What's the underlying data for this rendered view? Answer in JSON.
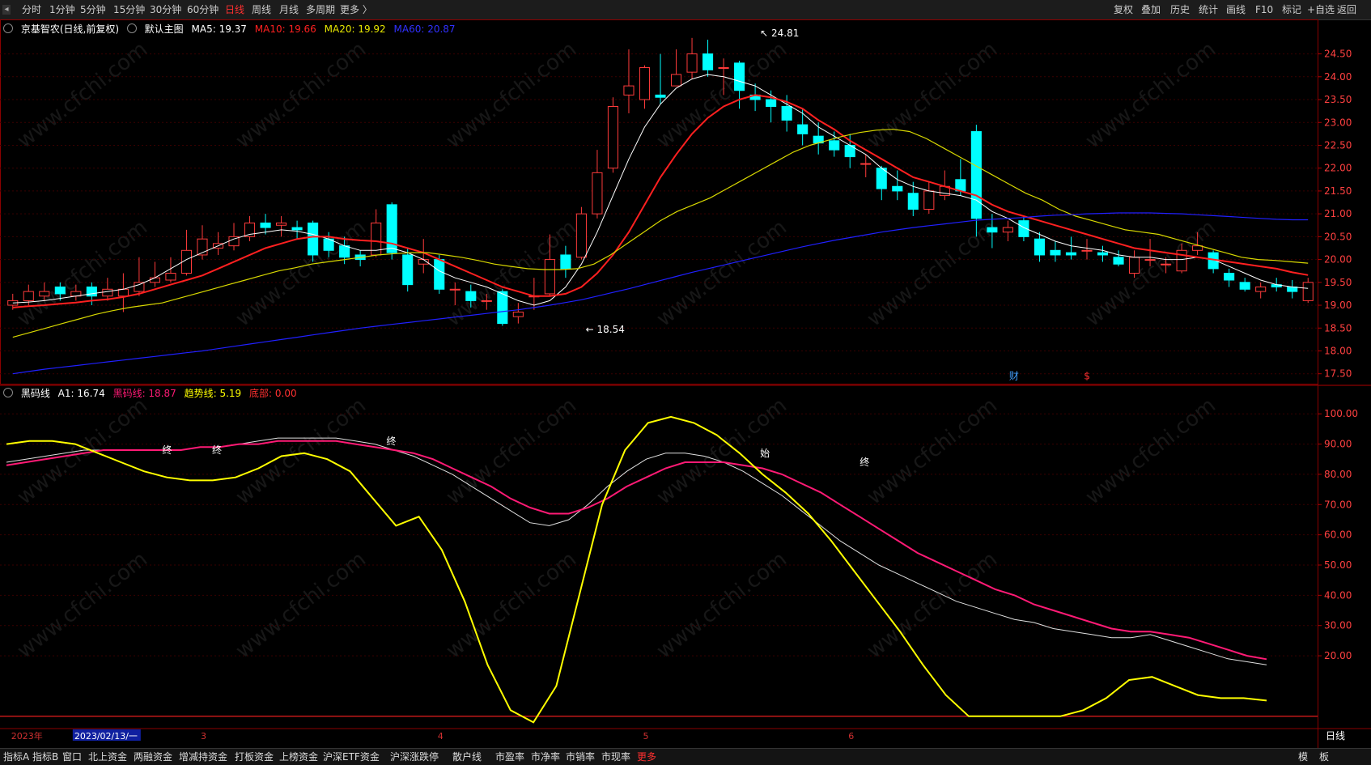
{
  "toolbar": {
    "periods": [
      "分时",
      "1分钟",
      "5分钟",
      "15分钟",
      "30分钟",
      "60分钟",
      "日线",
      "周线",
      "月线",
      "多周期",
      "更多 〉"
    ],
    "active_period": "日线",
    "right_buttons": [
      "复权",
      "叠加",
      "历史",
      "统计",
      "画线",
      "F10",
      "标记",
      "+自选",
      "返回"
    ]
  },
  "main_legend": {
    "stock": "京基智农(日线,前复权)",
    "template": "默认主图",
    "ma5": "MA5: 19.37",
    "ma10": "MA10: 19.66",
    "ma20": "MA20: 19.92",
    "ma60": "MA60: 20.87"
  },
  "sub_legend": {
    "name": "黑码线",
    "a1": "A1: 16.74",
    "hml": "黑码线: 18.87",
    "trend": "趋势线: 5.19",
    "bottom": "底部: 0.00"
  },
  "bottom_tabs": [
    "指标A",
    "指标B",
    "窗口",
    "北上资金",
    "两融资金",
    "增减持资金",
    "打板资金",
    "上榜资金",
    "沪深ETF资金",
    "沪深涨跌停",
    "散户线",
    "市盈率",
    "市净率",
    "市销率",
    "市现率",
    "更多"
  ],
  "bottom_right": [
    "模",
    "板"
  ],
  "period_label": "日线",
  "watermark": "www.cfchi.com",
  "colors": {
    "up": "#ff3b3b",
    "down": "#00ffff",
    "ma5": "#ffffff",
    "ma10": "#ff2020",
    "ma20": "#d8d800",
    "ma60": "#2020ff",
    "hml": "#ff1a75",
    "trend": "#ffff00",
    "a1": "#e0e0e0"
  },
  "chart_data": [
    {
      "type": "candlestick",
      "title": "京基智农(日线,前复权)",
      "ylim": [
        17.3,
        24.9
      ],
      "yticks": [
        17.5,
        18.0,
        18.5,
        19.0,
        19.5,
        20.0,
        20.5,
        21.0,
        21.5,
        22.0,
        22.5,
        23.0,
        23.5,
        24.0,
        24.5
      ],
      "annotations": [
        {
          "label": "24.81",
          "x": 30,
          "y": 24.81
        },
        {
          "label": "18.54",
          "x": 23,
          "y": 18.54
        },
        {
          "label": "财",
          "x": 40,
          "y": 17.45
        },
        {
          "label": "$",
          "x": 43,
          "y": 17.45
        }
      ],
      "x_labels": [
        {
          "label": "2023年",
          "x": 0
        },
        {
          "label": "2023/02/13/一",
          "x": 4
        },
        {
          "label": "3",
          "x": 12
        },
        {
          "label": "4",
          "x": 27
        },
        {
          "label": "5",
          "x": 40
        },
        {
          "label": "6",
          "x": 53
        }
      ],
      "candles": [
        [
          19.0,
          19.1,
          19.25,
          18.9
        ],
        [
          19.1,
          19.3,
          19.45,
          19.0
        ],
        [
          19.2,
          19.3,
          19.5,
          19.1
        ],
        [
          19.4,
          19.25,
          19.5,
          19.1
        ],
        [
          19.2,
          19.3,
          19.45,
          19.1
        ],
        [
          19.4,
          19.2,
          19.5,
          19.0
        ],
        [
          19.2,
          19.35,
          19.6,
          19.1
        ],
        [
          19.2,
          19.35,
          19.7,
          18.85
        ],
        [
          19.3,
          19.5,
          20.05,
          19.2
        ],
        [
          19.5,
          19.6,
          19.95,
          19.4
        ],
        [
          19.55,
          19.7,
          20.05,
          19.5
        ],
        [
          19.7,
          20.2,
          20.65,
          19.65
        ],
        [
          20.1,
          20.45,
          20.75,
          20.0
        ],
        [
          20.25,
          20.35,
          20.6,
          20.1
        ],
        [
          20.3,
          20.5,
          20.8,
          20.2
        ],
        [
          20.5,
          20.8,
          20.95,
          20.4
        ],
        [
          20.8,
          20.7,
          21.0,
          20.55
        ],
        [
          20.75,
          20.8,
          20.95,
          20.5
        ],
        [
          20.7,
          20.65,
          20.85,
          20.45
        ],
        [
          20.8,
          20.1,
          20.85,
          19.95
        ],
        [
          20.45,
          20.2,
          20.6,
          20.05
        ],
        [
          20.3,
          20.05,
          20.5,
          19.9
        ],
        [
          20.1,
          20.0,
          20.2,
          19.85
        ],
        [
          20.1,
          20.8,
          21.1,
          20.05
        ],
        [
          21.2,
          20.15,
          21.25,
          20.0
        ],
        [
          20.1,
          19.45,
          20.25,
          19.3
        ],
        [
          19.9,
          20.0,
          20.45,
          19.7
        ],
        [
          20.0,
          19.35,
          20.1,
          19.25
        ],
        [
          19.35,
          19.35,
          19.5,
          19.0
        ],
        [
          19.3,
          19.1,
          19.45,
          18.95
        ],
        [
          19.1,
          19.1,
          19.25,
          18.9
        ],
        [
          19.3,
          18.6,
          19.35,
          18.55
        ],
        [
          18.75,
          18.85,
          19.05,
          18.6
        ],
        [
          19.2,
          19.2,
          19.6,
          18.9
        ],
        [
          19.25,
          20.0,
          20.55,
          19.2
        ],
        [
          20.1,
          19.8,
          20.3,
          19.6
        ],
        [
          20.05,
          21.0,
          21.15,
          20.0
        ],
        [
          21.0,
          21.9,
          22.4,
          20.9
        ],
        [
          22.0,
          23.35,
          23.55,
          21.9
        ],
        [
          23.6,
          23.8,
          24.6,
          23.2
        ],
        [
          23.5,
          24.2,
          24.25,
          23.3
        ],
        [
          23.6,
          23.55,
          24.5,
          23.4
        ],
        [
          23.8,
          24.05,
          24.6,
          23.8
        ],
        [
          24.1,
          24.5,
          24.85,
          23.95
        ],
        [
          24.5,
          24.15,
          24.81,
          24.0
        ],
        [
          24.2,
          24.2,
          24.4,
          23.6
        ],
        [
          24.3,
          23.7,
          24.35,
          23.3
        ],
        [
          23.6,
          23.5,
          23.85,
          23.25
        ],
        [
          23.5,
          23.35,
          23.7,
          23.0
        ],
        [
          23.35,
          23.05,
          23.6,
          22.8
        ],
        [
          22.95,
          22.75,
          23.3,
          22.5
        ],
        [
          22.7,
          22.55,
          23.0,
          22.3
        ],
        [
          22.6,
          22.4,
          22.8,
          22.25
        ],
        [
          22.5,
          22.25,
          22.75,
          22.0
        ],
        [
          22.1,
          22.1,
          22.3,
          21.8
        ],
        [
          22.0,
          21.55,
          22.05,
          21.3
        ],
        [
          21.6,
          21.5,
          21.95,
          21.3
        ],
        [
          21.45,
          21.1,
          21.7,
          20.95
        ],
        [
          21.1,
          21.5,
          21.7,
          21.0
        ],
        [
          21.4,
          21.6,
          21.95,
          21.3
        ],
        [
          21.75,
          21.5,
          22.2,
          21.4
        ],
        [
          22.8,
          20.9,
          22.95,
          20.5
        ],
        [
          20.7,
          20.6,
          21.0,
          20.25
        ],
        [
          20.6,
          20.7,
          20.85,
          20.4
        ],
        [
          20.85,
          20.5,
          20.95,
          20.4
        ],
        [
          20.45,
          20.1,
          20.6,
          19.95
        ],
        [
          20.2,
          20.1,
          20.4,
          19.95
        ],
        [
          20.15,
          20.1,
          20.5,
          20.0
        ],
        [
          20.2,
          20.2,
          20.45,
          20.0
        ],
        [
          20.15,
          20.1,
          20.3,
          19.95
        ],
        [
          20.05,
          19.9,
          20.2,
          19.85
        ],
        [
          19.7,
          20.05,
          20.2,
          19.6
        ],
        [
          20.0,
          20.0,
          20.45,
          19.85
        ],
        [
          19.9,
          19.9,
          20.05,
          19.7
        ],
        [
          19.75,
          20.2,
          20.35,
          19.7
        ],
        [
          20.2,
          20.3,
          20.6,
          20.1
        ],
        [
          20.15,
          19.8,
          20.2,
          19.7
        ],
        [
          19.7,
          19.55,
          19.8,
          19.4
        ],
        [
          19.5,
          19.35,
          19.6,
          19.3
        ],
        [
          19.3,
          19.4,
          19.5,
          19.15
        ],
        [
          19.45,
          19.4,
          19.6,
          19.3
        ],
        [
          19.4,
          19.3,
          19.55,
          19.15
        ],
        [
          19.1,
          19.5,
          19.6,
          19.05
        ]
      ],
      "series": [
        {
          "name": "MA5",
          "values": [
            19.05,
            19.07,
            19.1,
            19.15,
            19.2,
            19.25,
            19.3,
            19.35,
            19.45,
            19.6,
            19.8,
            20.0,
            20.15,
            20.3,
            20.45,
            20.55,
            20.6,
            20.65,
            20.62,
            20.55,
            20.45,
            20.3,
            20.2,
            20.2,
            20.25,
            20.15,
            20.0,
            19.75,
            19.6,
            19.5,
            19.4,
            19.25,
            19.1,
            19.0,
            19.1,
            19.4,
            19.9,
            20.6,
            21.4,
            22.2,
            22.9,
            23.4,
            23.75,
            23.95,
            24.05,
            24.0,
            23.9,
            23.8,
            23.6,
            23.4,
            23.2,
            22.9,
            22.7,
            22.5,
            22.3,
            22.0,
            21.75,
            21.6,
            21.5,
            21.45,
            21.4,
            21.3,
            21.05,
            20.9,
            20.7,
            20.55,
            20.4,
            20.3,
            20.25,
            20.2,
            20.1,
            20.05,
            20.05,
            20.0,
            20.0,
            20.05,
            20.0,
            19.85,
            19.7,
            19.55,
            19.45,
            19.4,
            19.37
          ]
        },
        {
          "name": "MA10",
          "values": [
            18.95,
            18.98,
            19.0,
            19.03,
            19.06,
            19.1,
            19.13,
            19.18,
            19.25,
            19.35,
            19.45,
            19.55,
            19.65,
            19.8,
            19.95,
            20.1,
            20.25,
            20.35,
            20.45,
            20.5,
            20.5,
            20.45,
            20.42,
            20.4,
            20.35,
            20.25,
            20.15,
            20.0,
            19.85,
            19.7,
            19.55,
            19.4,
            19.3,
            19.2,
            19.2,
            19.25,
            19.4,
            19.7,
            20.1,
            20.6,
            21.2,
            21.8,
            22.3,
            22.75,
            23.1,
            23.35,
            23.5,
            23.6,
            23.55,
            23.45,
            23.3,
            23.05,
            22.85,
            22.6,
            22.4,
            22.2,
            22.0,
            21.8,
            21.7,
            21.6,
            21.5,
            21.4,
            21.2,
            21.05,
            20.95,
            20.85,
            20.75,
            20.65,
            20.55,
            20.45,
            20.35,
            20.25,
            20.2,
            20.15,
            20.1,
            20.05,
            20.0,
            19.95,
            19.9,
            19.85,
            19.8,
            19.72,
            19.66
          ]
        },
        {
          "name": "MA20",
          "values": [
            18.3,
            18.4,
            18.5,
            18.6,
            18.7,
            18.8,
            18.88,
            18.95,
            19.0,
            19.05,
            19.15,
            19.25,
            19.35,
            19.45,
            19.55,
            19.65,
            19.75,
            19.82,
            19.9,
            19.95,
            20.0,
            20.05,
            20.1,
            20.13,
            20.15,
            20.15,
            20.1,
            20.05,
            19.98,
            19.9,
            19.85,
            19.8,
            19.78,
            19.78,
            19.8,
            19.9,
            20.1,
            20.35,
            20.6,
            20.85,
            21.05,
            21.2,
            21.35,
            21.55,
            21.75,
            21.95,
            22.15,
            22.35,
            22.5,
            22.6,
            22.7,
            22.78,
            22.83,
            22.85,
            22.8,
            22.65,
            22.45,
            22.25,
            22.05,
            21.85,
            21.65,
            21.45,
            21.3,
            21.1,
            20.95,
            20.85,
            20.75,
            20.65,
            20.6,
            20.55,
            20.45,
            20.35,
            20.25,
            20.15,
            20.05,
            20.0,
            19.98,
            19.95,
            19.92
          ]
        },
        {
          "name": "MA60",
          "values": [
            17.5,
            17.55,
            17.6,
            17.64,
            17.68,
            17.72,
            17.76,
            17.8,
            17.84,
            17.88,
            17.92,
            17.96,
            18.0,
            18.05,
            18.1,
            18.15,
            18.2,
            18.25,
            18.3,
            18.35,
            18.4,
            18.45,
            18.5,
            18.54,
            18.58,
            18.62,
            18.66,
            18.7,
            18.74,
            18.78,
            18.82,
            18.86,
            18.9,
            18.95,
            19.0,
            19.06,
            19.12,
            19.2,
            19.28,
            19.36,
            19.45,
            19.54,
            19.63,
            19.72,
            19.8,
            19.88,
            19.96,
            20.04,
            20.12,
            20.2,
            20.28,
            20.35,
            20.42,
            20.48,
            20.54,
            20.6,
            20.65,
            20.7,
            20.74,
            20.78,
            20.82,
            20.86,
            20.88,
            20.9,
            20.92,
            20.95,
            20.97,
            20.98,
            21.0,
            21.01,
            21.02,
            21.02,
            21.02,
            21.01,
            21.0,
            20.98,
            20.96,
            20.94,
            20.92,
            20.9,
            20.88,
            20.87,
            20.87
          ]
        }
      ]
    },
    {
      "type": "line",
      "title": "黑码线",
      "ylim": [
        -3,
        103
      ],
      "yticks": [
        20,
        30,
        40,
        50,
        60,
        70,
        80,
        90,
        100
      ],
      "baseline": 0,
      "annotations": [
        {
          "label": "终",
          "x": 6,
          "y": 88
        },
        {
          "label": "终",
          "x": 8,
          "y": 88
        },
        {
          "label": "终",
          "x": 15,
          "y": 91
        },
        {
          "label": "始",
          "x": 30,
          "y": 87
        },
        {
          "label": "终",
          "x": 34,
          "y": 84
        }
      ],
      "series": [
        {
          "name": "A1",
          "values": [
            84,
            85,
            86,
            87,
            88,
            88,
            88,
            88,
            88,
            88,
            89,
            89,
            90,
            91,
            92,
            92,
            92,
            92,
            91,
            90,
            88,
            86,
            83,
            80,
            76,
            72,
            68,
            64,
            63,
            65,
            70,
            76,
            81,
            85,
            87,
            87,
            86,
            84,
            81,
            77,
            73,
            68,
            63,
            58,
            54,
            50,
            47,
            44,
            41,
            38,
            36,
            34,
            32,
            31,
            29,
            28,
            27,
            26,
            26,
            27,
            25,
            23,
            21,
            19,
            18,
            17
          ]
        },
        {
          "name": "黑码线",
          "values": [
            83,
            84,
            85,
            86,
            87,
            88,
            88,
            88,
            88,
            88,
            89,
            89,
            90,
            90,
            91,
            91,
            91,
            91,
            90,
            89,
            88,
            87,
            85,
            82,
            79,
            76,
            72,
            69,
            67,
            67,
            69,
            72,
            76,
            79,
            82,
            84,
            84,
            84,
            83,
            82,
            80,
            77,
            74,
            70,
            66,
            62,
            58,
            54,
            51,
            48,
            45,
            42,
            40,
            37,
            35,
            33,
            31,
            29,
            28,
            28,
            27,
            26,
            24,
            22,
            20,
            18.87
          ]
        },
        {
          "name": "趋势线",
          "values": [
            90,
            91,
            91,
            90,
            87,
            84,
            81,
            79,
            78,
            78,
            79,
            82,
            86,
            87,
            85,
            81,
            72,
            63,
            66,
            55,
            38,
            17,
            2,
            -2,
            10,
            40,
            70,
            88,
            97,
            99,
            97,
            93,
            87,
            80,
            74,
            67,
            58,
            48,
            38,
            28,
            17,
            7,
            0,
            0,
            0,
            0,
            0,
            2,
            6,
            12,
            13,
            10,
            7,
            6,
            6,
            5.19
          ]
        }
      ]
    }
  ]
}
